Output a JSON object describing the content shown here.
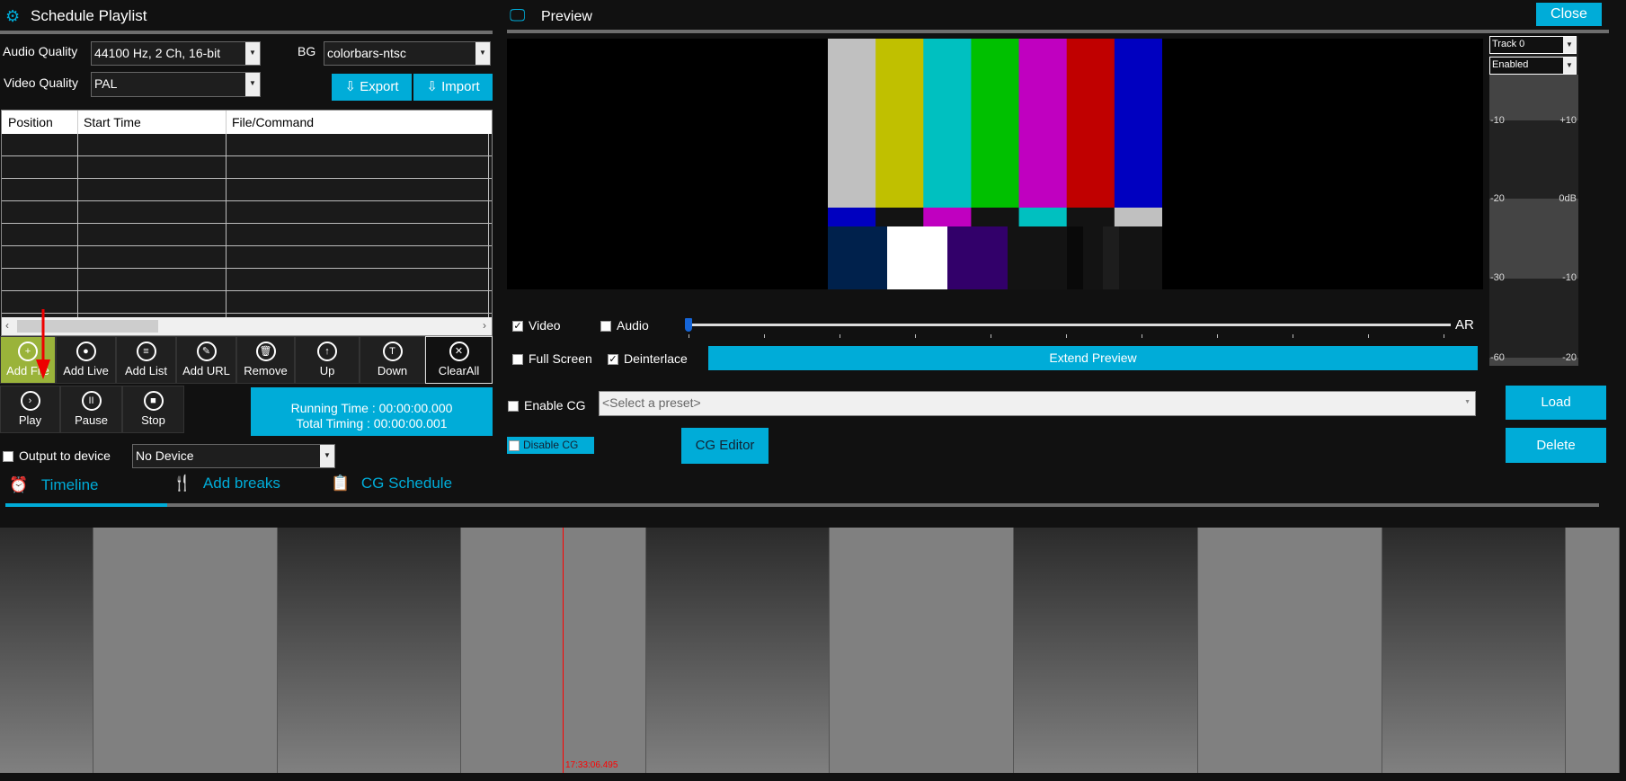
{
  "left": {
    "title": "Schedule Playlist",
    "audio_quality_label": "Audio Quality",
    "audio_quality_value": "44100 Hz, 2 Ch, 16-bit",
    "bg_label": "BG",
    "bg_value": "colorbars-ntsc",
    "video_quality_label": "Video Quality",
    "video_quality_value": "PAL",
    "export_label": "Export",
    "import_label": "Import",
    "table": {
      "columns": [
        "Position",
        "Start Time",
        "File/Command"
      ],
      "rows": []
    },
    "toolbar": [
      {
        "label": "Add File",
        "icon": "add-file-icon",
        "glyph": "+"
      },
      {
        "label": "Add Live",
        "icon": "live-icon",
        "glyph": "●"
      },
      {
        "label": "Add List",
        "icon": "list-icon",
        "glyph": "≡"
      },
      {
        "label": "Add URL",
        "icon": "url-icon",
        "glyph": "✎"
      },
      {
        "label": "Remove",
        "icon": "trash-icon",
        "glyph": "🗑"
      },
      {
        "label": "Up",
        "icon": "upload-icon",
        "glyph": "↑"
      },
      {
        "label": "Down",
        "icon": "download-icon",
        "glyph": "T"
      },
      {
        "label": "ClearAll",
        "icon": "close-icon",
        "glyph": "✕"
      }
    ],
    "transport": [
      {
        "label": "Play",
        "icon": "play-icon",
        "glyph": "›"
      },
      {
        "label": "Pause",
        "icon": "pause-icon",
        "glyph": "II"
      },
      {
        "label": "Stop",
        "icon": "stop-icon",
        "glyph": "■"
      }
    ],
    "running_time": "Running Time : 00:00:00.000",
    "total_timing": "Total Timing : 00:00:00.001",
    "output_label": "Output to device",
    "output_value": "No Device",
    "tabs": [
      "Timeline",
      "Add breaks",
      "CG Schedule"
    ],
    "active_tab": "Timeline"
  },
  "preview": {
    "title": "Preview",
    "close_label": "Close",
    "track_value": "Track 0",
    "enabled_value": "Enabled",
    "meter_left": [
      "-10",
      "-20",
      "-30",
      "-60"
    ],
    "meter_right": [
      "+10",
      "0dB",
      "-10",
      "-20"
    ],
    "video_label": "Video",
    "video_checked": true,
    "audio_label": "Audio",
    "audio_checked": false,
    "slider_value": 0,
    "ar_label": "AR",
    "fullscreen_label": "Full Screen",
    "fullscreen_checked": false,
    "deinterlace_label": "Deinterlace",
    "deinterlace_checked": true,
    "extend_label": "Extend Preview",
    "enable_cg_label": "Enable CG",
    "preset_placeholder": "<Select a preset>",
    "load_label": "Load",
    "delete_label": "Delete",
    "disable_cg_label": "Disable CG",
    "cg_editor_label": "CG Editor"
  },
  "timeline": {
    "cursor_time": "17:33:06.495"
  },
  "colors": {
    "accent": "#00acd8",
    "active_button": "#9ab33a",
    "cursor": "#ff0000"
  }
}
